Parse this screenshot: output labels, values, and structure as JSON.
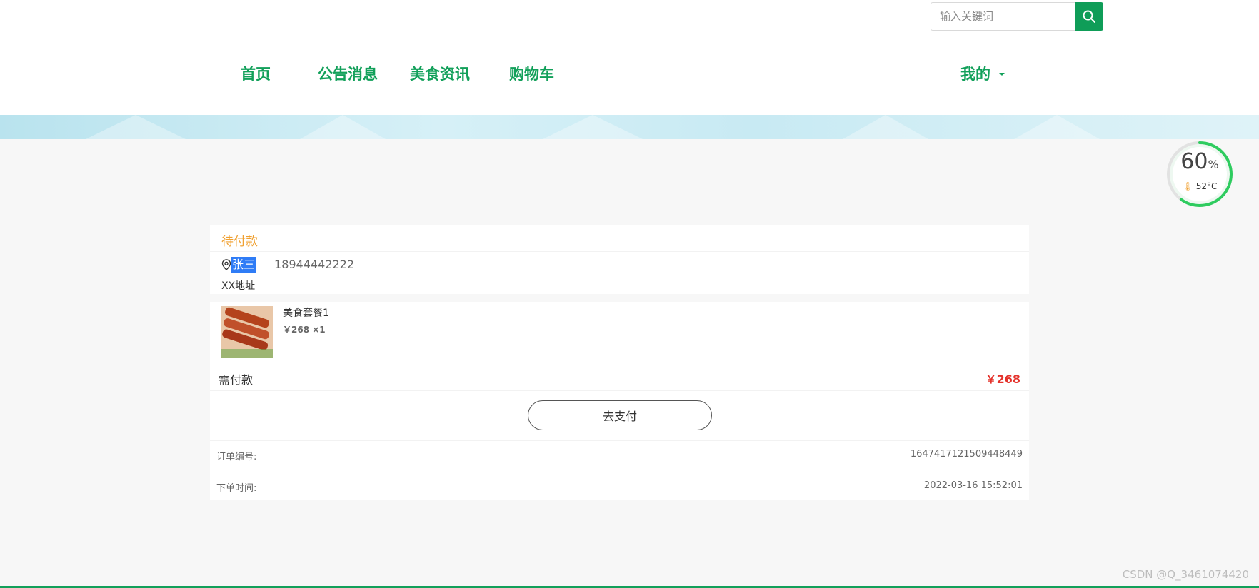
{
  "search": {
    "placeholder": "输入关键词"
  },
  "nav": {
    "items": [
      {
        "label": "首页"
      },
      {
        "label": "公告消息"
      },
      {
        "label": "美食资讯"
      },
      {
        "label": "购物车"
      }
    ],
    "mine_label": "我的"
  },
  "gauge": {
    "percent": "60",
    "percent_unit": "%",
    "temperature": "52°C",
    "fill_fraction": 0.6
  },
  "order": {
    "status": "待付款",
    "receiver": {
      "name": "张三",
      "phone": "18944442222",
      "address": "XX地址"
    },
    "goods": [
      {
        "name": "美食套餐1",
        "price_qty": "￥268 ×1"
      }
    ],
    "pay_label": "需付款",
    "pay_amount": "￥268",
    "pay_button": "去支付",
    "order_no_label": "订单编号:",
    "order_no": "1647417121509448449",
    "order_time_label": "下单时间:",
    "order_time": "2022-03-16 15:52:01"
  },
  "watermark": "CSDN @Q_3461074420",
  "colors": {
    "brand": "#12a05a",
    "status": "#f0a030",
    "price": "#e4322b",
    "selection": "#2f7cf6"
  }
}
